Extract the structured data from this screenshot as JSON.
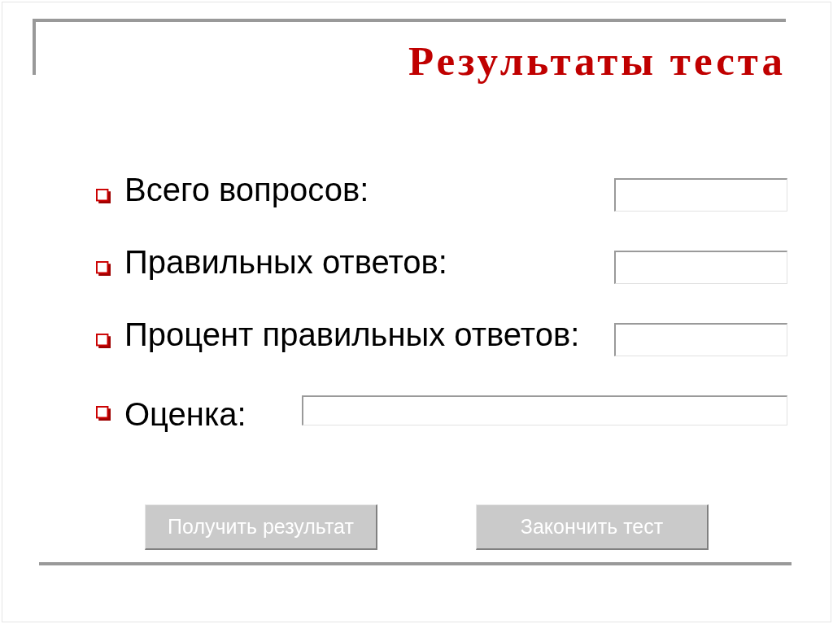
{
  "title": "Результаты теста",
  "fields": [
    {
      "label": "Всего вопросов:",
      "kind": "short"
    },
    {
      "label": "Правильных ответов:",
      "kind": "short"
    },
    {
      "label": "Процент правильных ответов:",
      "kind": "short"
    },
    {
      "label": "Оценка:",
      "kind": "wide"
    }
  ],
  "buttons": [
    {
      "label": "Получить результат",
      "disabled": true
    },
    {
      "label": "Закончить тест",
      "disabled": true
    }
  ]
}
